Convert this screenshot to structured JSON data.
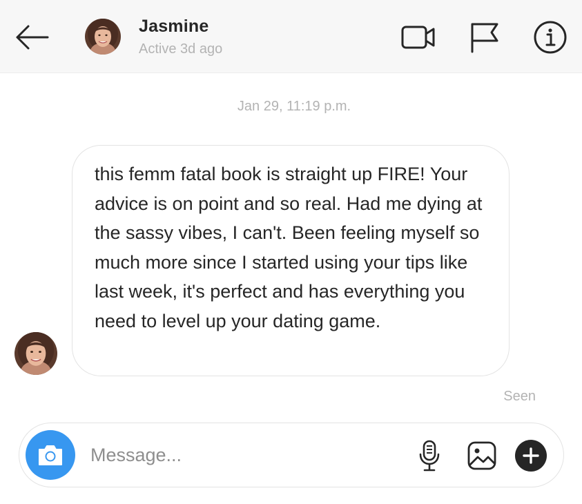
{
  "header": {
    "contact_name": "Jasmine",
    "status": "Active 3d ago",
    "icons": {
      "back": "arrow-left-icon",
      "video": "video-camera-icon",
      "flag": "flag-icon",
      "info": "info-icon"
    }
  },
  "conversation": {
    "timestamp": "Jan 29, 11:19 p.m.",
    "messages": [
      {
        "sender": "Jasmine",
        "text": "this femm fatal book is straight up FIRE! Your advice is on point and so real. Had me dying at the sassy vibes, I can't. Been feeling myself so much more since I started using your tips like last week, it's perfect and has everything you need to level up your dating game."
      }
    ],
    "seen_label": "Seen"
  },
  "composer": {
    "placeholder": "Message...",
    "value": "",
    "icons": {
      "camera": "camera-icon",
      "mic": "microphone-icon",
      "gallery": "image-gallery-icon",
      "plus": "plus-circle-icon"
    }
  },
  "colors": {
    "accent": "#3797f0",
    "header_bg": "#f7f7f7",
    "text_primary": "#262626",
    "text_secondary": "#b3b3b3",
    "border": "#e3e3e3"
  }
}
